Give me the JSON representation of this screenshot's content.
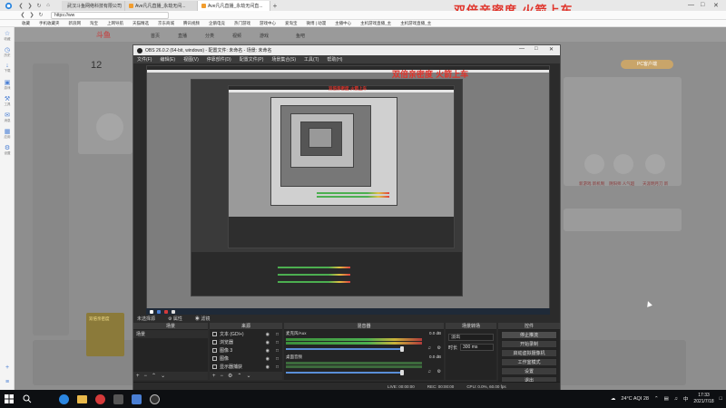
{
  "banner": {
    "text": "双倍亲密度   火箭上车"
  },
  "tabs": [
    {
      "label": "武汉斗鱼网络科技有限公司",
      "active": false,
      "color": "#f29d2e"
    },
    {
      "label": "Ave凡凡直播_永劫无间...",
      "active": false,
      "color": "#f29d2e"
    },
    {
      "label": "Ave凡凡直播_永劫无间直...",
      "active": true,
      "color": "#f29d2e"
    }
  ],
  "address": {
    "url": "https://ww"
  },
  "bookmarks": [
    {
      "label": "收藏",
      "color": "#f0b400"
    },
    {
      "label": "手机收藏夹",
      "color": "#4a7fd4"
    },
    {
      "label": "新浪网",
      "color": "#d43a3a"
    },
    {
      "label": "淘宝",
      "color": "#f05a1a"
    },
    {
      "label": "上网导航",
      "color": "#4a7fd4"
    },
    {
      "label": "天猫精选",
      "color": "#d43a3a"
    },
    {
      "label": "京东商城",
      "color": "#d43a3a"
    },
    {
      "label": "腾讯视频",
      "color": "#f29d2e"
    },
    {
      "label": "企鹅电竞",
      "color": "#4a7fd4"
    },
    {
      "label": "热门游戏",
      "color": "#d43a3a"
    },
    {
      "label": "游戏中心",
      "color": "#4a7fd4"
    },
    {
      "label": "爱淘宝",
      "color": "#f05a1a"
    },
    {
      "label": "微博 | 动漫",
      "color": "#d43a3a"
    },
    {
      "label": "主播中心",
      "color": "#4a7fd4"
    },
    {
      "label": "主机游戏直播_主",
      "color": "#f29d2e"
    },
    {
      "label": "主机游戏直播_主",
      "color": "#f29d2e"
    }
  ],
  "site": {
    "logo": "斗鱼",
    "nav": [
      "首页",
      "直播",
      "分类",
      "视频",
      "游戏",
      "鱼吧"
    ],
    "num": "12",
    "pill": "PC客户端",
    "game_labels": [
      "新游戏 新机制",
      "阴阳师 人气超",
      "天涯明月刀 新"
    ]
  },
  "obs": {
    "title": "OBS 26.0.2 (64-bit, windows) - 配置文件: 未命名 - 场景: 未命名",
    "menu": [
      "文件(F)",
      "编辑(E)",
      "视图(V)",
      "停靠部件(D)",
      "配置文件(P)",
      "场景集合(S)",
      "工具(T)",
      "帮助(H)"
    ],
    "status_tabs": [
      "未选择源",
      "属性",
      "滤镜"
    ],
    "scenes_title": "场景",
    "scenes": [
      "场景"
    ],
    "sources_title": "来源",
    "sources": [
      {
        "name": "文本 (GDI+)"
      },
      {
        "name": "浏览器"
      },
      {
        "name": "图像 3"
      },
      {
        "name": "图像"
      },
      {
        "name": "显示器捕获"
      }
    ],
    "mixer_title": "混音器",
    "mixer": [
      {
        "name": "麦克风/Aux",
        "db": "0.0 dB"
      },
      {
        "name": "桌面音频",
        "db": "0.0 dB"
      }
    ],
    "transitions_title": "场景转场",
    "transition": "淡出",
    "duration_label": "时长",
    "duration": "300 ms",
    "controls_title": "控件",
    "controls": [
      "停止推流",
      "开始录制",
      "启动虚拟摄像机",
      "工作室模式",
      "设置",
      "退出"
    ],
    "status": {
      "live": "LIVE: 00:00:00",
      "rec": "REC: 00:00:00",
      "cpu": "CPU: 0.0%, 60.00 fps"
    },
    "promo_label": "双倍亲密度"
  },
  "taskbar": {
    "weather": "24°C  AQI 28",
    "lang": "中",
    "time": "17:33",
    "date": "2021/7/18"
  },
  "sidebar": [
    "收藏",
    "历史",
    "下载",
    "游戏",
    "工具",
    "消息",
    "应用",
    "设置"
  ]
}
